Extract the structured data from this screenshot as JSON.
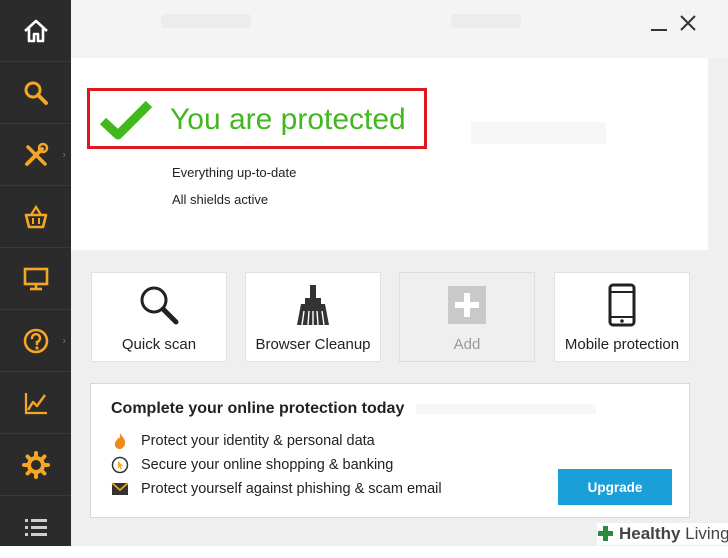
{
  "window": {
    "minimize_label": "—",
    "close_label": "×"
  },
  "sidebar": {
    "items": [
      {
        "name": "home",
        "icon": "home-icon"
      },
      {
        "name": "search",
        "icon": "search-icon"
      },
      {
        "name": "tools",
        "icon": "tools-icon"
      },
      {
        "name": "store",
        "icon": "basket-icon"
      },
      {
        "name": "display",
        "icon": "monitor-icon"
      },
      {
        "name": "help",
        "icon": "help-icon"
      },
      {
        "name": "statistics",
        "icon": "chart-icon"
      },
      {
        "name": "settings",
        "icon": "gear-icon"
      },
      {
        "name": "menu",
        "icon": "menu-icon"
      }
    ],
    "icon_color": "#f5a623"
  },
  "status": {
    "title": "You are protected",
    "line1": "Everything up-to-date",
    "line2": "All shields active",
    "accent": "#42b81e",
    "highlight": "#e0171f"
  },
  "tiles": [
    {
      "label": "Quick scan",
      "icon": "magnifier-icon"
    },
    {
      "label": "Browser Cleanup",
      "icon": "broom-icon"
    },
    {
      "label": "Add",
      "icon": "plus-icon"
    },
    {
      "label": "Mobile protection",
      "icon": "phone-icon"
    }
  ],
  "promo": {
    "title": "Complete your online protection today",
    "features": [
      {
        "text": "Protect your identity & personal data",
        "icon": "flame-icon"
      },
      {
        "text": "Secure your online shopping & banking",
        "icon": "cursor-icon"
      },
      {
        "text": "Protect yourself against phishing & scam email",
        "icon": "envelope-icon"
      }
    ],
    "button_label": "Upgrade",
    "button_color": "#1a9fd8"
  },
  "watermark": {
    "brand_bold": "Healthy",
    "brand_light": " Living"
  }
}
